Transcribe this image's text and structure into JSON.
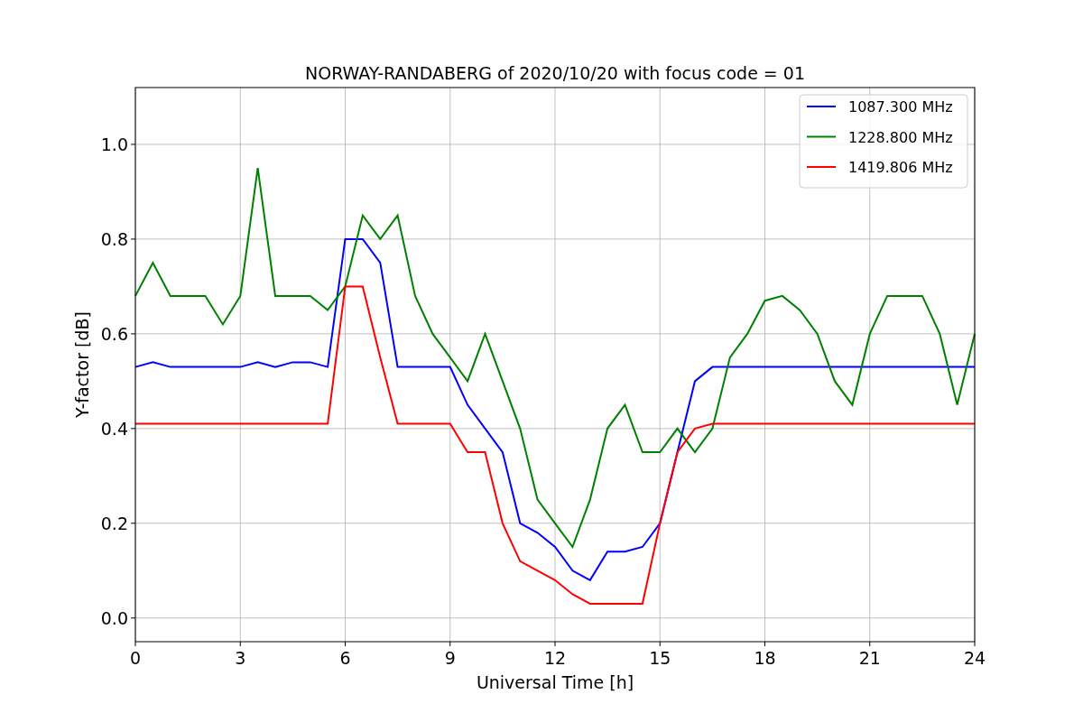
{
  "figure": {
    "chart_data": {
      "type": "line",
      "title": "NORWAY-RANDABERG of 2020/10/20 with focus code = 01",
      "xlabel": "Universal Time [h]",
      "ylabel": "Y-factor [dB]",
      "x": [
        0,
        0.5,
        1,
        1.5,
        2,
        2.5,
        3,
        3.5,
        4,
        4.5,
        5,
        5.5,
        6,
        6.5,
        7,
        7.5,
        8,
        8.5,
        9,
        9.5,
        10,
        10.5,
        11,
        11.5,
        12,
        12.5,
        13,
        13.5,
        14,
        14.5,
        15,
        15.5,
        16,
        16.5,
        17,
        17.5,
        18,
        18.5,
        19,
        19.5,
        20,
        20.5,
        21,
        21.5,
        22,
        22.5,
        23,
        23.5,
        24
      ],
      "series": [
        {
          "name": "1087.300 MHz",
          "color": "#0000ff",
          "values": [
            0.53,
            0.54,
            0.53,
            0.53,
            0.53,
            0.53,
            0.53,
            0.54,
            0.53,
            0.54,
            0.54,
            0.53,
            0.8,
            0.8,
            0.75,
            0.53,
            0.53,
            0.53,
            0.53,
            0.45,
            0.4,
            0.35,
            0.2,
            0.18,
            0.15,
            0.1,
            0.08,
            0.14,
            0.14,
            0.15,
            0.2,
            0.35,
            0.5,
            0.53,
            0.53,
            0.53,
            0.53,
            0.53,
            0.53,
            0.53,
            0.53,
            0.53,
            0.53,
            0.53,
            0.53,
            0.53,
            0.53,
            0.53,
            0.53
          ]
        },
        {
          "name": "1228.800 MHz",
          "color": "#008000",
          "values": [
            0.68,
            0.75,
            0.68,
            0.68,
            0.68,
            0.62,
            0.68,
            0.95,
            0.68,
            0.68,
            0.68,
            0.65,
            0.7,
            0.85,
            0.8,
            0.85,
            0.68,
            0.6,
            0.55,
            0.5,
            0.6,
            0.5,
            0.4,
            0.25,
            0.2,
            0.15,
            0.25,
            0.4,
            0.45,
            0.35,
            0.35,
            0.4,
            0.35,
            0.4,
            0.55,
            0.6,
            0.67,
            0.68,
            0.65,
            0.6,
            0.5,
            0.45,
            0.6,
            0.68,
            0.68,
            0.68,
            0.6,
            0.45,
            0.6
          ]
        },
        {
          "name": "1419.806 MHz",
          "color": "#ff0000",
          "values": [
            0.41,
            0.41,
            0.41,
            0.41,
            0.41,
            0.41,
            0.41,
            0.41,
            0.41,
            0.41,
            0.41,
            0.41,
            0.7,
            0.7,
            0.55,
            0.41,
            0.41,
            0.41,
            0.41,
            0.35,
            0.35,
            0.2,
            0.12,
            0.1,
            0.08,
            0.05,
            0.03,
            0.03,
            0.03,
            0.03,
            0.2,
            0.35,
            0.4,
            0.41,
            0.41,
            0.41,
            0.41,
            0.41,
            0.41,
            0.41,
            0.41,
            0.41,
            0.41,
            0.41,
            0.41,
            0.41,
            0.41,
            0.41,
            0.41
          ]
        }
      ],
      "grid": true,
      "legend": true,
      "xlim": [
        0,
        24
      ],
      "ylim": [
        -0.05,
        1.12
      ],
      "xticks": [
        0,
        3,
        6,
        9,
        12,
        15,
        18,
        21,
        24
      ],
      "yticks": [
        {
          "value": 0,
          "label": "0.0"
        },
        {
          "value": 0.2,
          "label": "0.2"
        },
        {
          "value": 0.4,
          "label": "0.4"
        },
        {
          "value": 0.6,
          "label": "0.6"
        },
        {
          "value": 0.8,
          "label": "0.8"
        },
        {
          "value": 1,
          "label": "1.0"
        }
      ]
    }
  }
}
